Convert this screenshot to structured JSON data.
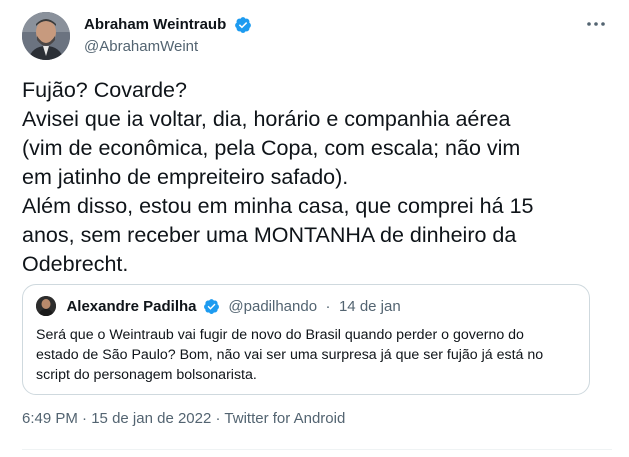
{
  "author": {
    "display_name": "Abraham Weintraub",
    "handle": "@AbrahamWeint"
  },
  "tweet": {
    "lines": [
      "Fujão? Covarde?",
      "Avisei que ia voltar, dia, horário e companhia aérea",
      "(vim de econômica, pela Copa, com escala; não vim",
      "em jatinho de empreiteiro safado).",
      "Além disso, estou em minha casa, que comprei há 15",
      "anos, sem receber uma MONTANHA de dinheiro da",
      "Odebrecht."
    ]
  },
  "quote": {
    "display_name": "Alexandre Padilha",
    "handle": "@padilhando",
    "separator": "·",
    "date": "14 de jan",
    "lines": [
      "Será que o Weintraub vai fugir de novo do Brasil quando perder o governo do",
      "estado de São Paulo? Bom, não vai ser uma surpresa já que ser fujão já está no",
      "script do personagem bolsonarista."
    ]
  },
  "meta": {
    "time": "6:49 PM",
    "separator": "·",
    "date": "15 de jan de 2022",
    "source": "Twitter for Android"
  },
  "icons": {
    "verified": "verified-badge-icon",
    "more": "more-options-icon"
  },
  "colors": {
    "verified_blue": "#1d9bf0",
    "secondary_text": "#536471",
    "border": "#cfd9de"
  }
}
